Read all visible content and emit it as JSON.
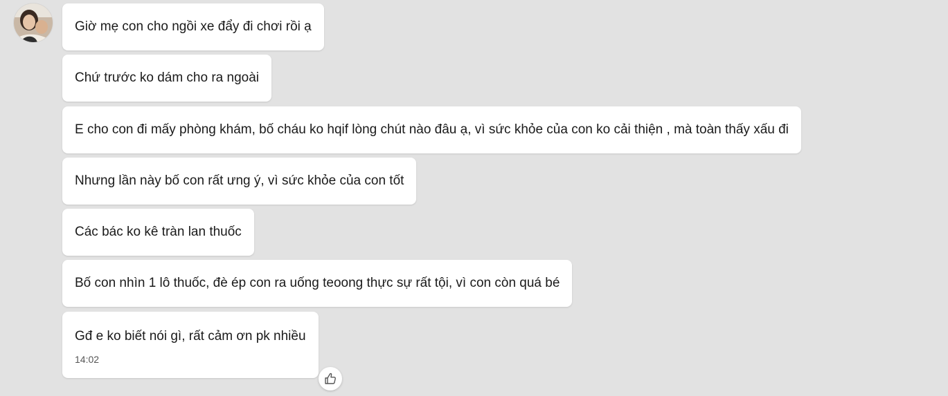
{
  "conversation": {
    "avatar_icon": "user-avatar-photo",
    "messages": [
      {
        "text": "Giờ mẹ con cho ngồi xe đẩy đi chơi rồi ạ"
      },
      {
        "text": "Chứ trước ko dám cho ra ngoài"
      },
      {
        "text": "E cho con đi mấy phòng khám, bố cháu ko hqif lòng chút nào đâu ạ, vì sức khỏe của con ko cải thiện , mà toàn thấy xấu đi"
      },
      {
        "text": "Nhưng lần này bố con rất ưng ý, vì sức khỏe của con tốt"
      },
      {
        "text": "Các bác ko kê tràn lan thuốc"
      },
      {
        "text": "Bố con nhìn 1 lô thuốc, đè ép con ra uống teoong thực sự rất tội, vì con còn quá bé"
      },
      {
        "text": "Gđ e ko biết nói gì, rất cảm ơn pk nhiều",
        "time": "14:02"
      }
    ],
    "reaction_icon": "thumbs-up-icon"
  },
  "colors": {
    "background": "#e2e2e2",
    "bubble": "#ffffff",
    "text": "#1a1a1a",
    "timestamp": "#555555"
  }
}
